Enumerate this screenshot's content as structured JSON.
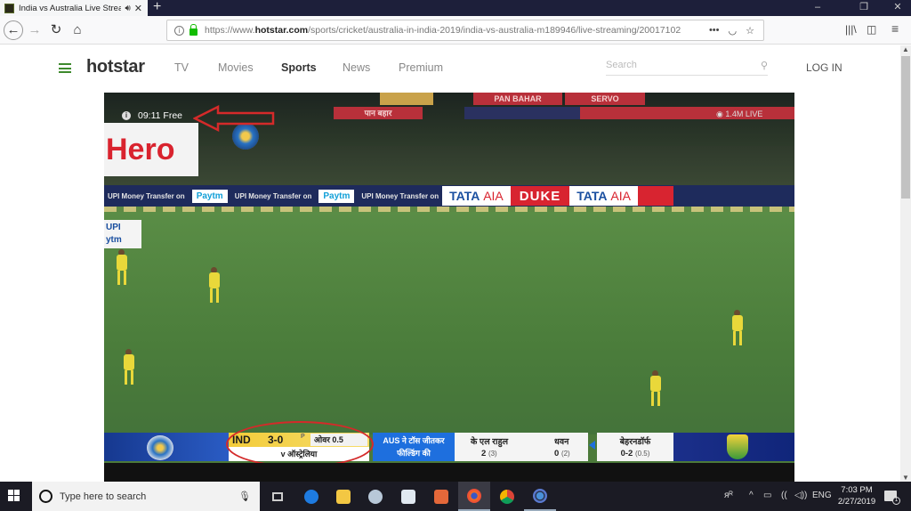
{
  "browser": {
    "tab": {
      "title": "India vs Australia Live Stream",
      "audio_icon": "speaker-icon",
      "close_icon": "close-icon"
    },
    "new_tab_label": "+",
    "window_controls": {
      "minimize": "–",
      "restore": "❐",
      "close": "✕"
    },
    "nav": {
      "back": "←",
      "forward": "→",
      "reload": "↻",
      "home": "⌂"
    },
    "url": {
      "prefix": "https://www.",
      "domain": "hotstar.com",
      "path": "/sports/cricket/australia-in-india-2019/india-vs-australia-m189946/live-streaming/20017102"
    },
    "url_icons": {
      "more": "•••",
      "pocket": "◡",
      "bookmark": "☆"
    },
    "toolbar_right": {
      "library": "|||\\",
      "sidebar": "◫",
      "menu": "≡"
    }
  },
  "site": {
    "logo": "hotstar",
    "nav": [
      {
        "label": "TV",
        "active": false
      },
      {
        "label": "Movies",
        "active": false
      },
      {
        "label": "Sports",
        "active": true
      },
      {
        "label": "News",
        "active": false
      },
      {
        "label": "Premium",
        "active": false
      }
    ],
    "search_placeholder": "Search",
    "login_label": "LOG IN",
    "accent_color": "#3e8a2d"
  },
  "player": {
    "timer_text": "09:11 Free",
    "viewers_text": "1.4M LIVE",
    "hoardings": {
      "top": [
        "PAN BAHAR",
        "SERVO",
        "पान बहार"
      ],
      "hero": "Hero",
      "upi": "UPI",
      "upi2": "ytm",
      "paytm_text": "UPI Money Transfer on",
      "paytm": "Paytm",
      "tata": "TATA",
      "aia": "AIA",
      "duke": "DUKE"
    },
    "scoreboard": {
      "team": "IND",
      "score": "3-0",
      "powerplay": "P",
      "overs": "ओवर 0.5",
      "opponent": "v ऑस्ट्रेलिया",
      "toss_line1": "AUS ने टॉस जीतकर",
      "toss_line2": "फील्डिंग की",
      "batsmen": [
        {
          "name": "के एल राहुल",
          "runs": "2",
          "balls": "(3)"
        },
        {
          "name": "धवन",
          "runs": "0",
          "balls": "(2)"
        }
      ],
      "bowler": {
        "name": "बेहरनडॉर्फ",
        "figures": "0-2",
        "overs": "(0.5)"
      }
    }
  },
  "taskbar": {
    "search_placeholder": "Type here to search",
    "apps": [
      "task-view",
      "edge",
      "file-explorer",
      "paint",
      "photos",
      "reader",
      "firefox",
      "chrome",
      "app"
    ],
    "tray": {
      "people": "ᴙᴿ",
      "chevron": "^",
      "battery": "▭",
      "wifi": "((",
      "volume": "◁))",
      "lang": "ENG"
    },
    "time": "7:03 PM",
    "date": "2/27/2019",
    "notifications": "1"
  }
}
